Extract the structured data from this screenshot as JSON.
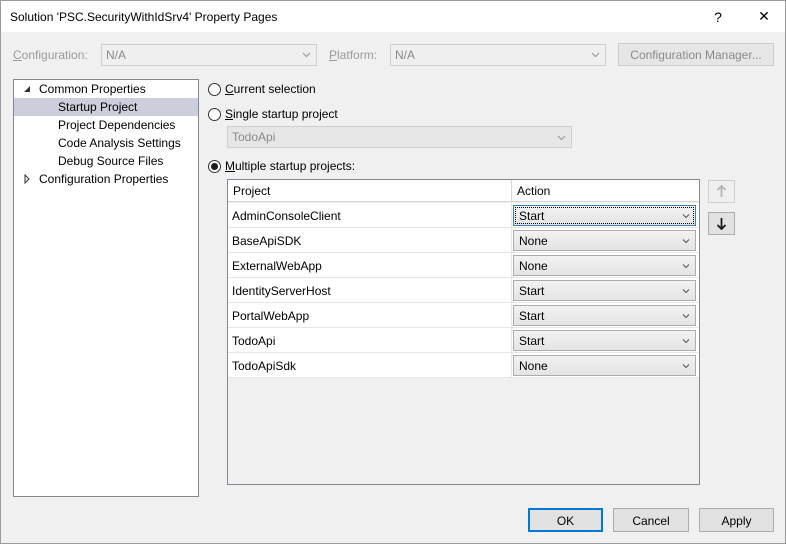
{
  "window": {
    "title": "Solution 'PSC.SecurityWithIdSrv4' Property Pages",
    "help_label": "?",
    "close_label": "✕"
  },
  "config_bar": {
    "configuration_label": "Configuration:",
    "configuration_value": "N/A",
    "platform_label": "Platform:",
    "platform_value": "N/A",
    "config_manager_label": "Configuration Manager..."
  },
  "tree": {
    "items": [
      {
        "label": "Common Properties",
        "expanded": true
      },
      {
        "label": "Startup Project",
        "selected": true
      },
      {
        "label": "Project Dependencies"
      },
      {
        "label": "Code Analysis Settings"
      },
      {
        "label": "Debug Source Files"
      },
      {
        "label": "Configuration Properties",
        "expanded": false
      }
    ]
  },
  "startup": {
    "current_selection_label": "Current selection",
    "single_label": "Single startup project",
    "single_value": "TodoApi",
    "multiple_label": "Multiple startup projects:",
    "selected_option": "multiple"
  },
  "grid": {
    "columns": [
      "Project",
      "Action"
    ],
    "rows": [
      {
        "project": "AdminConsoleClient",
        "action": "Start"
      },
      {
        "project": "BaseApiSDK",
        "action": "None"
      },
      {
        "project": "ExternalWebApp",
        "action": "None"
      },
      {
        "project": "IdentityServerHost",
        "action": "Start"
      },
      {
        "project": "PortalWebApp",
        "action": "Start"
      },
      {
        "project": "TodoApi",
        "action": "Start"
      },
      {
        "project": "TodoApiSdk",
        "action": "None"
      }
    ]
  },
  "buttons": {
    "ok_label": "OK",
    "cancel_label": "Cancel",
    "apply_label": "Apply"
  }
}
